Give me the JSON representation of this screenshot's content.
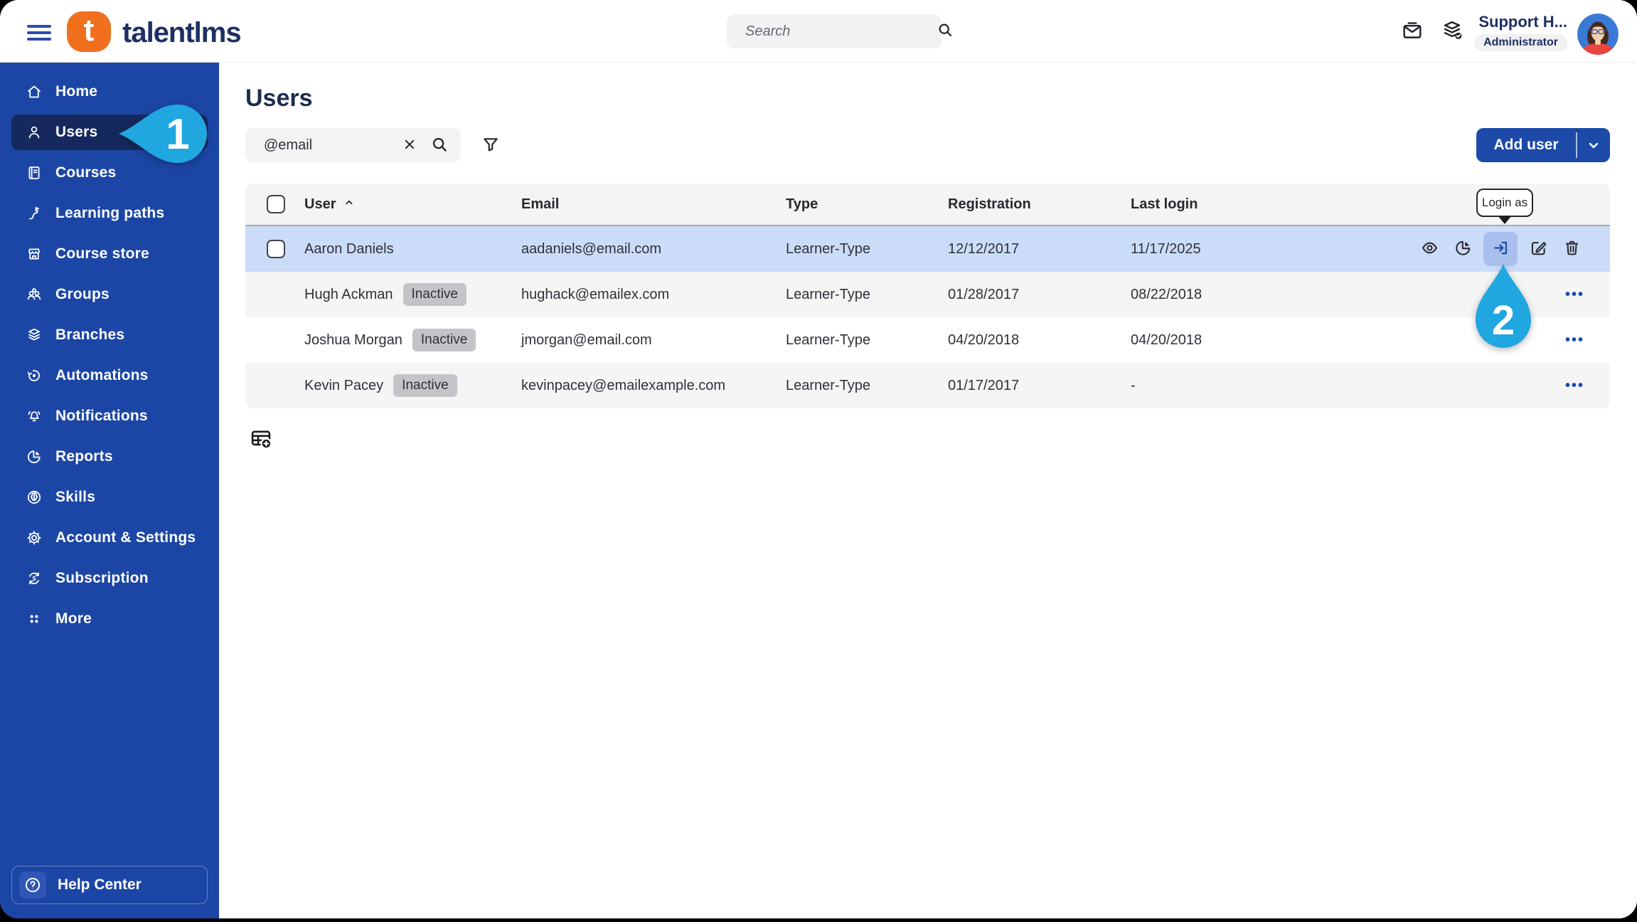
{
  "topbar": {
    "logo_mark": "t",
    "logo_text": "talentlms",
    "search_placeholder": "Search",
    "user_name": "Support H...",
    "user_role": "Administrator"
  },
  "sidebar": {
    "items": [
      {
        "label": "Home",
        "icon": "home-icon",
        "active": false
      },
      {
        "label": "Users",
        "icon": "users-icon",
        "active": true
      },
      {
        "label": "Courses",
        "icon": "courses-icon",
        "active": false
      },
      {
        "label": "Learning paths",
        "icon": "learning-paths-icon",
        "active": false
      },
      {
        "label": "Course store",
        "icon": "course-store-icon",
        "active": false
      },
      {
        "label": "Groups",
        "icon": "groups-icon",
        "active": false
      },
      {
        "label": "Branches",
        "icon": "branches-icon",
        "active": false
      },
      {
        "label": "Automations",
        "icon": "automations-icon",
        "active": false
      },
      {
        "label": "Notifications",
        "icon": "notifications-icon",
        "active": false
      },
      {
        "label": "Reports",
        "icon": "reports-icon",
        "active": false
      },
      {
        "label": "Skills",
        "icon": "skills-icon",
        "active": false
      },
      {
        "label": "Account & Settings",
        "icon": "settings-icon",
        "active": false
      },
      {
        "label": "Subscription",
        "icon": "subscription-icon",
        "active": false
      },
      {
        "label": "More",
        "icon": "more-icon",
        "active": false
      }
    ],
    "help_label": "Help Center"
  },
  "main": {
    "title": "Users",
    "search_value": "@email",
    "add_user_label": "Add user",
    "login_tooltip": "Login as",
    "more_label": "•••",
    "table": {
      "columns": [
        "User",
        "Email",
        "Type",
        "Registration",
        "Last login"
      ],
      "sort_column": "User",
      "sort_direction": "ascending",
      "rows": [
        {
          "name": "Aaron Daniels",
          "status": "",
          "email": "aadaniels@email.com",
          "type": "Learner-Type",
          "registration": "12/12/2017",
          "last_login": "11/17/2025",
          "selected": true,
          "bg": "selected"
        },
        {
          "name": "Hugh Ackman",
          "status": "Inactive",
          "email": "hughack@emailex.com",
          "type": "Learner-Type",
          "registration": "01/28/2017",
          "last_login": "08/22/2018",
          "selected": false,
          "bg": "alt"
        },
        {
          "name": "Joshua Morgan",
          "status": "Inactive",
          "email": "jmorgan@email.com",
          "type": "Learner-Type",
          "registration": "04/20/2018",
          "last_login": "04/20/2018",
          "selected": false,
          "bg": "plain"
        },
        {
          "name": "Kevin Pacey",
          "status": "Inactive",
          "email": "kevinpacey@emailexample.com",
          "type": "Learner-Type",
          "registration": "01/17/2017",
          "last_login": "-",
          "selected": false,
          "bg": "alt"
        }
      ],
      "row_actions": [
        "preview",
        "reports",
        "login-as",
        "edit",
        "delete"
      ]
    },
    "markers": {
      "step1": "1",
      "step2": "2"
    }
  },
  "colors": {
    "sidebar_blue": "#1c46a5",
    "active_item_navy": "#15295e",
    "brand_orange": "#f0701e",
    "navy_text": "#1d3064",
    "accent_blue": "#1d4aa8",
    "marker_cyan": "#21a7e0",
    "row_highlight": "#cbdcf9",
    "login_button_bg": "#a9c0ef",
    "inactive_badge": "#c2c4c8"
  }
}
